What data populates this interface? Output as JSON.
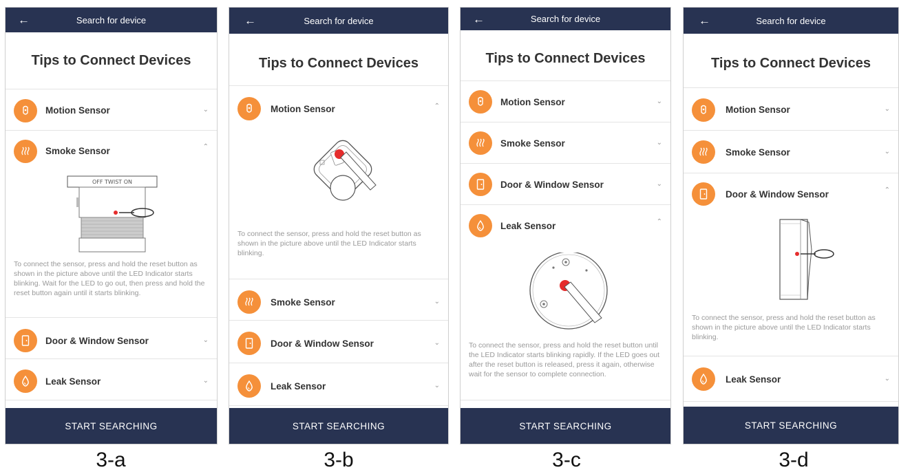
{
  "header": {
    "title": "Search for device",
    "back_icon": "arrow-left-icon"
  },
  "page_title": "Tips to Connect Devices",
  "sensors": {
    "motion": "Motion Sensor",
    "smoke": "Smoke Sensor",
    "door_window": "Door & Window Sensor",
    "leak": "Leak Sensor"
  },
  "smoke_dial_text": "OFF TWIST ON",
  "instructions": {
    "smoke": "To connect the sensor, press and hold the reset button as shown in the picture above until the LED Indicator starts blinking. Wait for the LED to go out, then press and hold the reset button again until it starts blinking.",
    "motion": "To connect the sensor, press and hold the reset button as shown in the picture above until the LED Indicator starts blinking.",
    "leak": "To connect the sensor, press and hold the reset button until the LED Indicator starts blinking rapidly. If the LED goes out after the reset button is released, press it again, otherwise wait for the sensor to complete connection.",
    "door_window": "To connect the sensor, press and hold the reset button as shown in the picture above until the LED Indicator starts blinking."
  },
  "start_button": "START SEARCHING",
  "captions": [
    "3-a",
    "3-b",
    "3-c",
    "3-d"
  ],
  "colors": {
    "navy": "#283352",
    "orange": "#f5903a",
    "red": "#e52d2d"
  }
}
